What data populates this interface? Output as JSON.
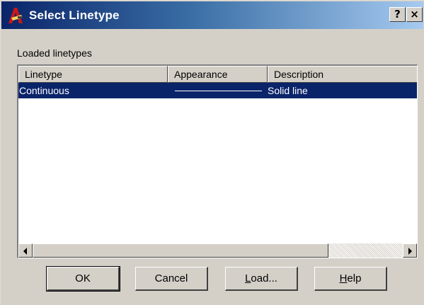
{
  "window": {
    "title": "Select Linetype",
    "icon": "autocad-app-icon",
    "help_label": "?",
    "close_label": "×"
  },
  "group": {
    "label": "Loaded linetypes"
  },
  "list": {
    "columns": [
      "Linetype",
      "Appearance",
      "Description"
    ],
    "rows": [
      {
        "linetype": "Continuous",
        "appearance": "solid-line-sample",
        "description": "Solid line",
        "selected": true
      }
    ]
  },
  "buttons": {
    "ok": {
      "label": "OK"
    },
    "cancel": {
      "label": "Cancel"
    },
    "load": {
      "label_rest": "oad...",
      "mnemonic": "L"
    },
    "help": {
      "label_rest": "elp",
      "mnemonic": "H"
    }
  },
  "colors": {
    "selection": "#0a246a",
    "title_start": "#0a246a",
    "title_end": "#a6caf0",
    "face": "#d4d0c8"
  }
}
